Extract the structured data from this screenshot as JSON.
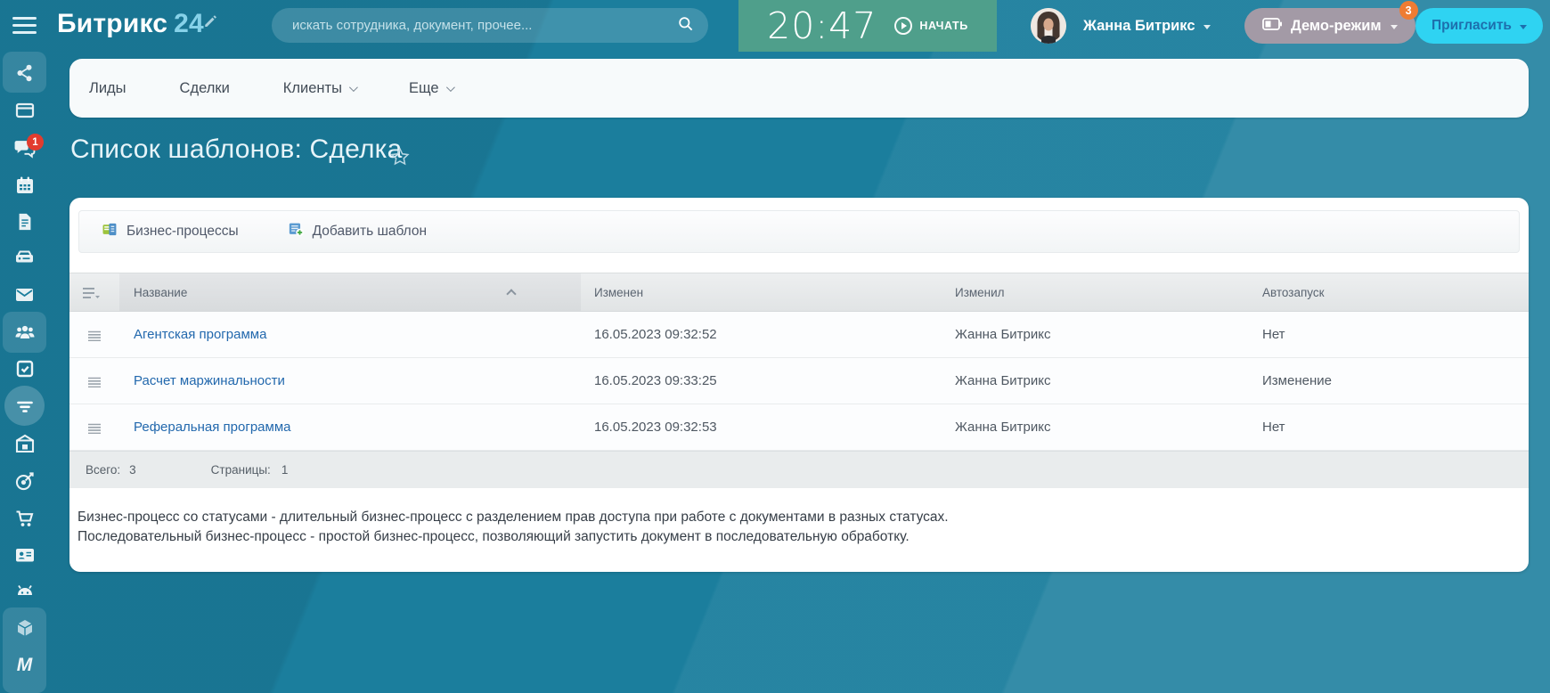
{
  "header": {
    "logo": {
      "brand": "Битрикс",
      "suffix": "24"
    },
    "search": {
      "placeholder": "искать сотрудника, документ, прочее..."
    },
    "clock": {
      "time": "20:47",
      "start_label": "НАЧАТЬ"
    },
    "user": {
      "name": "Жанна Битрикс"
    },
    "demo": {
      "label": "Демо-режим",
      "badge": "3"
    },
    "invite": {
      "label": "Пригласить"
    }
  },
  "sidebar": {
    "chat_badge": "1",
    "m_label": "M",
    "icons": [
      "community-icon",
      "desktop-icon",
      "chat-icon",
      "calendar-icon",
      "document-icon",
      "drive-icon",
      "mail-icon",
      "people-icon",
      "tasks-icon",
      "crm-funnel-icon",
      "warehouse-icon",
      "marketing-target-icon",
      "shop-cart-icon",
      "contact-card-icon",
      "robot-icon",
      "sites-cube-icon",
      "market-m-icon"
    ]
  },
  "nav": {
    "tabs": [
      {
        "label": "Лиды",
        "has_dropdown": false
      },
      {
        "label": "Сделки",
        "has_dropdown": false
      },
      {
        "label": "Клиенты",
        "has_dropdown": true
      },
      {
        "label": "Еще",
        "has_dropdown": true
      }
    ]
  },
  "page": {
    "title": "Список шаблонов: Сделка"
  },
  "toolbar": {
    "buttons": [
      {
        "label": "Бизнес-процессы"
      },
      {
        "label": "Добавить шаблон"
      }
    ]
  },
  "table": {
    "columns": [
      "Название",
      "Изменен",
      "Изменил",
      "Автозапуск"
    ],
    "rows": [
      {
        "name": "Агентская программа",
        "modified": "16.05.2023 09:32:52",
        "modified_by": "Жанна Битрикс",
        "autorun": "Нет"
      },
      {
        "name": "Расчет маржинальности",
        "modified": "16.05.2023 09:33:25",
        "modified_by": "Жанна Битрикс",
        "autorun": "Изменение"
      },
      {
        "name": "Реферальная программа",
        "modified": "16.05.2023 09:32:53",
        "modified_by": "Жанна Битрикс",
        "autorun": "Нет"
      }
    ],
    "footer": {
      "total_label": "Всего:",
      "total_value": "3",
      "pages_label": "Страницы:",
      "pages_value": "1"
    }
  },
  "description": {
    "line1": "Бизнес-процесс со статусами - длительный бизнес-процесс с разделением прав доступа при работе с документами в разных статусах.",
    "line2": "Последовательный бизнес-процесс - простой бизнес-процесс, позволяющий запустить документ в последовательную обработку."
  },
  "colors": {
    "teal_background": "#1b7e9d",
    "clock_green": "#4f9f8b",
    "demo_pill": "#a39aa6",
    "invite_cyan": "#2fd3f2",
    "invite_text": "#1d6fad",
    "link_blue": "#2268ad",
    "chat_badge_red": "#e23c2e",
    "demo_badge_orange": "#ee7c33"
  }
}
